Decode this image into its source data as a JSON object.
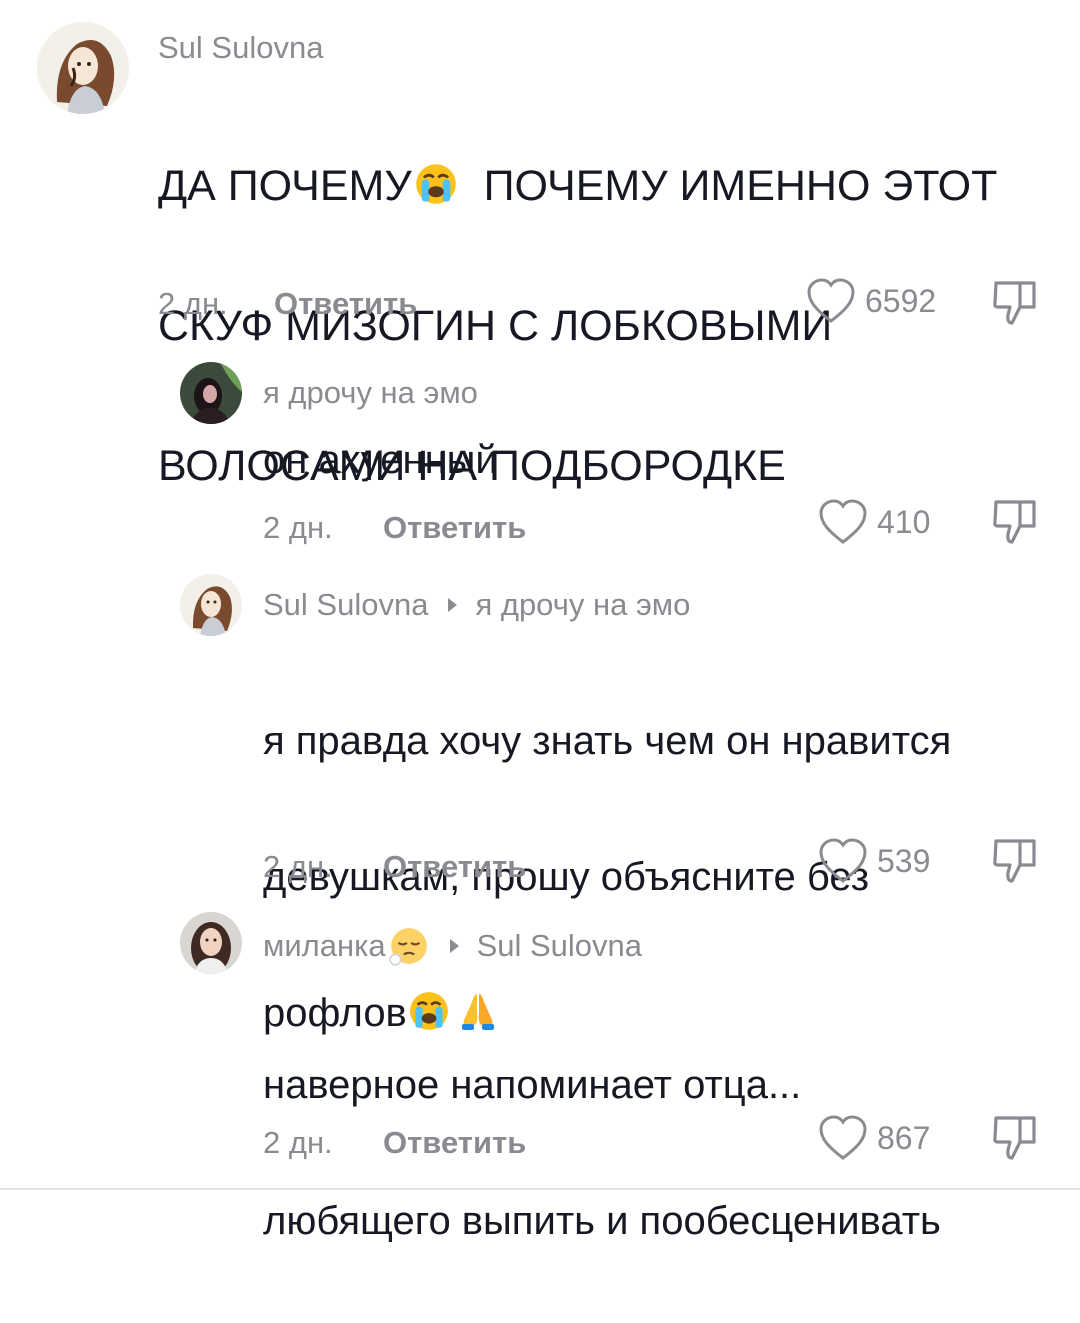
{
  "comments": [
    {
      "username": "Sul Sulovna",
      "reply_to": "",
      "text_lines": [
        "ДА ПОЧЕМУ",
        "ПОЧЕМУ ИМЕННО ЭТОТ",
        "СКУФ МИЗОГИН С ЛОБКОВЫМИ",
        "ВОЛОСАМИ НА ПОДБОРОДКЕ"
      ],
      "age": "2 дн.",
      "reply_label": "Ответить",
      "likes": "6592",
      "avatar": "woman-drawing-avatar"
    },
    {
      "username": "я дрочу на эмо",
      "reply_to": "",
      "text": "он ахуенный",
      "age": "2 дн.",
      "reply_label": "Ответить",
      "likes": "410",
      "avatar": "dark-photo-avatar"
    },
    {
      "username": "Sul Sulovna",
      "reply_to": "я дрочу на эмо",
      "text_line1": "я правда хочу знать чем он нравится",
      "text_line2": "девушкам, прошу объясните без",
      "text_line3": "рофлов",
      "age": "2 дн.",
      "reply_label": "Ответить",
      "likes": "539",
      "avatar": "woman-drawing-avatar"
    },
    {
      "username": "миланка",
      "reply_to": "Sul Sulovna",
      "text_line1": "наверное напоминает отца...",
      "text_line2": "любящего выпить и пообесценивать",
      "age": "2 дн.",
      "reply_label": "Ответить",
      "likes": "867",
      "avatar": "girl-photo-avatar"
    }
  ],
  "icons": {
    "like": "heart-outline-icon",
    "dislike": "thumbs-down-icon",
    "crying": "loudly-crying-face-emoji",
    "praying": "folded-hands-emoji",
    "sleepy": "sleepy-face-emoji"
  }
}
